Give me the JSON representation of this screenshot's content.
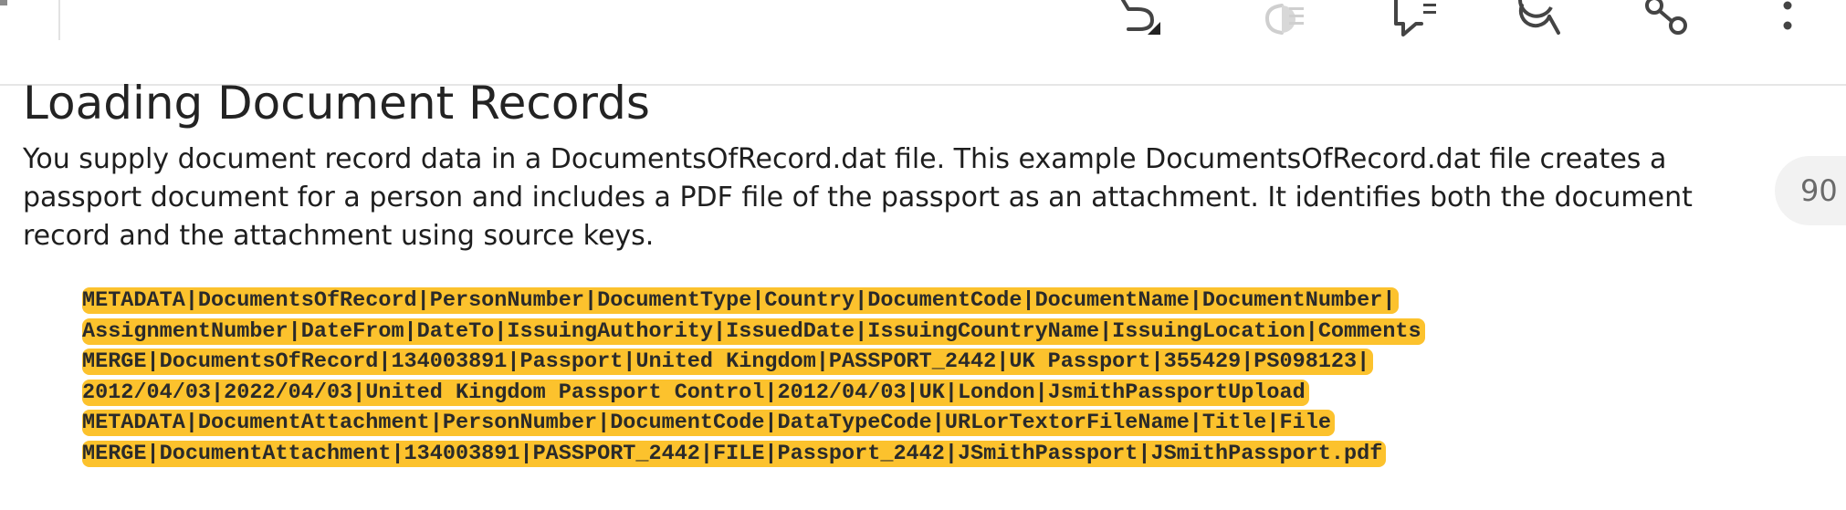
{
  "toolbar": {
    "icons": [
      "undo-icon",
      "text-format-icon",
      "comment-icon",
      "search-icon",
      "share-icon",
      "more-vertical-icon"
    ]
  },
  "page": {
    "title": "Loading Document Records",
    "intro": "You supply document record data in a DocumentsOfRecord.dat file. This example DocumentsOfRecord.dat file creates a passport document for a person and includes a PDF file of the passport as an attachment. It identifies both the document record and the attachment using source keys.",
    "page_number": "90"
  },
  "code": {
    "lines": [
      "METADATA|DocumentsOfRecord|PersonNumber|DocumentType|Country|DocumentCode|DocumentName|DocumentNumber|",
      "AssignmentNumber|DateFrom|DateTo|IssuingAuthority|IssuedDate|IssuingCountryName|IssuingLocation|Comments",
      "MERGE|DocumentsOfRecord|134003891|Passport|United Kingdom|PASSPORT_2442|UK Passport|355429|PS098123|",
      "2012/04/03|2022/04/03|United Kingdom Passport Control|2012/04/03|UK|London|JsmithPassportUpload",
      "METADATA|DocumentAttachment|PersonNumber|DocumentCode|DataTypeCode|URLorTextorFileName|Title|File",
      "MERGE|DocumentAttachment|134003891|PASSPORT_2442|FILE|Passport_2442|JSmithPassport|JSmithPassport.pdf"
    ],
    "highlight_color": "#fcc22d"
  }
}
